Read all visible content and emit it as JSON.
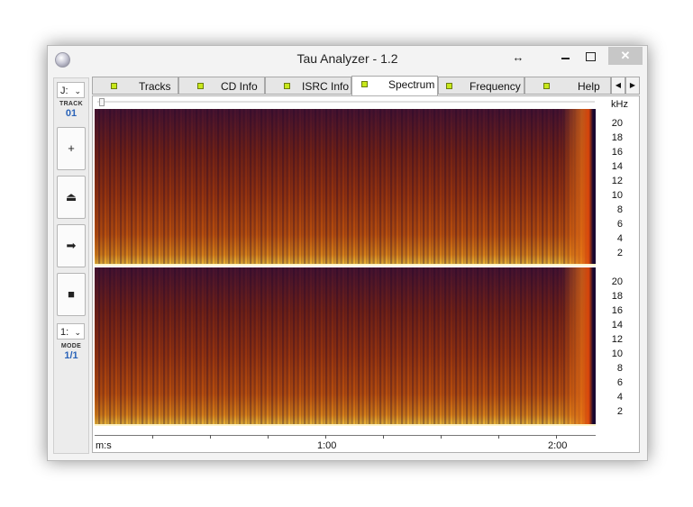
{
  "window": {
    "title": "Tau Analyzer - 1.2",
    "resize_glyph": "↔",
    "close_glyph": "✕"
  },
  "left_panel": {
    "drive_combo": "J:",
    "track_label": "TRACK",
    "track_value": "01",
    "buttons": [
      {
        "icon": "plus-icon",
        "glyph": "+"
      },
      {
        "icon": "eject-icon",
        "glyph": "⏏"
      },
      {
        "icon": "arrow-right-icon",
        "glyph": "➡"
      },
      {
        "icon": "stop-icon",
        "glyph": "■"
      }
    ],
    "mode_combo": "1:",
    "mode_label": "MODE",
    "mode_value": "1/1"
  },
  "tabs": [
    {
      "label": "Tracks",
      "active": false
    },
    {
      "label": "CD Info",
      "active": false
    },
    {
      "label": "ISRC Info",
      "active": false
    },
    {
      "label": "Spectrum",
      "active": true
    },
    {
      "label": "Frequency",
      "active": false
    },
    {
      "label": "Help",
      "active": false
    }
  ],
  "tab_scroll": {
    "left": "◀",
    "right": "▶"
  },
  "spectrum": {
    "freq_unit": "kHz",
    "freq_ticks": [
      "20",
      "18",
      "16",
      "14",
      "12",
      "10",
      "8",
      "6",
      "4",
      "2"
    ],
    "time_unit": "m:s",
    "time_ticks": [
      "1:00",
      "2:00"
    ],
    "colors": {
      "background": "#2b0c3a",
      "low": "#7a2413",
      "mid": "#c8560a",
      "high": "#ffd040"
    }
  }
}
